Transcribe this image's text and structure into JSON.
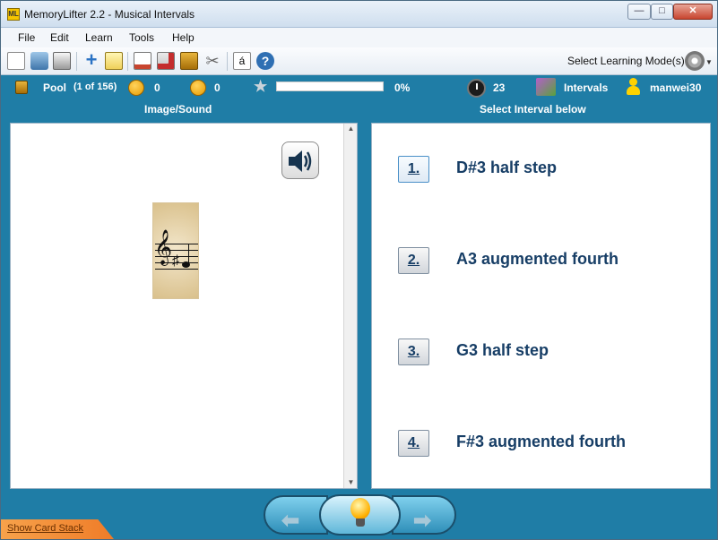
{
  "window": {
    "title": "MemoryLifter 2.2 - Musical Intervals",
    "app_icon_text": "ML"
  },
  "menu": [
    "File",
    "Edit",
    "Learn",
    "Tools",
    "Help"
  ],
  "toolbar": {
    "learning_mode_label": "Select Learning Mode(s)",
    "icons": [
      "new-icon",
      "open-icon",
      "print-icon",
      "add-icon",
      "edit-icon",
      "presentation-icon",
      "stats-icon",
      "book-icon",
      "settings-tools-icon",
      "special-char-icon",
      "help-icon"
    ]
  },
  "status": {
    "pool_label": "Pool",
    "pool_count": "(1 of 156)",
    "right_count": "0",
    "wrong_count": "0",
    "progress_percent": "0%",
    "progress_value": 0,
    "timer_value": "23",
    "category": "Intervals",
    "username": "manwei30"
  },
  "panels": {
    "left_title": "Image/Sound",
    "right_title": "Select Interval below"
  },
  "answers": [
    {
      "number": "1.",
      "text": "D#3 half step"
    },
    {
      "number": "2.",
      "text": "A3 augmented fourth"
    },
    {
      "number": "3.",
      "text": "G3 half step"
    },
    {
      "number": "4.",
      "text": "F#3 augmented fourth"
    }
  ],
  "bottom": {
    "show_card_stack": "Show Card Stack"
  },
  "colors": {
    "frame": "#1f7da6",
    "answer_text": "#173e66",
    "progress_fill": "#6fbf4d"
  }
}
